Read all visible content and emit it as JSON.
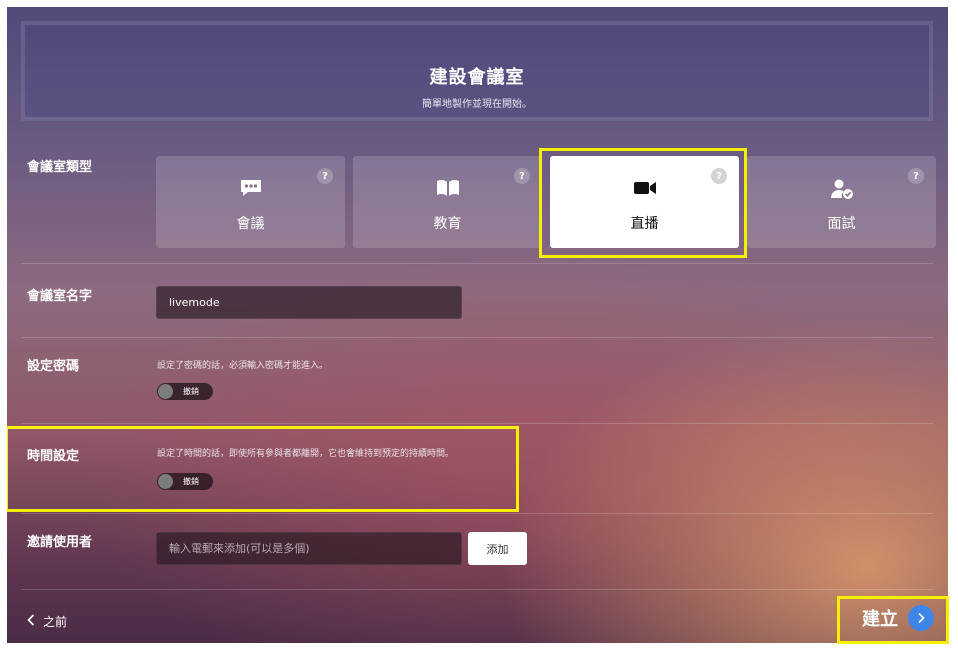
{
  "header": {
    "title": "建設會議室",
    "subtitle": "簡單地製作並現在開始。"
  },
  "room_type": {
    "label": "會議室類型",
    "help_glyph": "?",
    "options": [
      {
        "label": "會議",
        "icon": "chat-bubble-icon",
        "selected": false
      },
      {
        "label": "教育",
        "icon": "open-book-icon",
        "selected": false
      },
      {
        "label": "直播",
        "icon": "video-camera-icon",
        "selected": true
      },
      {
        "label": "面試",
        "icon": "user-check-icon",
        "selected": false
      }
    ]
  },
  "room_name": {
    "label": "會議室名字",
    "value": "livemode"
  },
  "password": {
    "label": "設定密碼",
    "hint": "設定了密碼的話，必須輸入密碼才能進入。",
    "toggle_text": "撤銷",
    "enabled": false
  },
  "time_setting": {
    "label": "時間設定",
    "hint": "設定了時間的話，即使所有參與者都離開，它也會維持到预定的持續時間。",
    "toggle_text": "撤銷",
    "enabled": false
  },
  "invite": {
    "label": "邀請使用者",
    "placeholder": "輸入電郵來添加(可以是多個)",
    "add_label": "添加"
  },
  "footer": {
    "back_label": "之前",
    "create_label": "建立"
  },
  "colors": {
    "highlight": "#f4f000",
    "create_circle": "#3d86e8"
  }
}
